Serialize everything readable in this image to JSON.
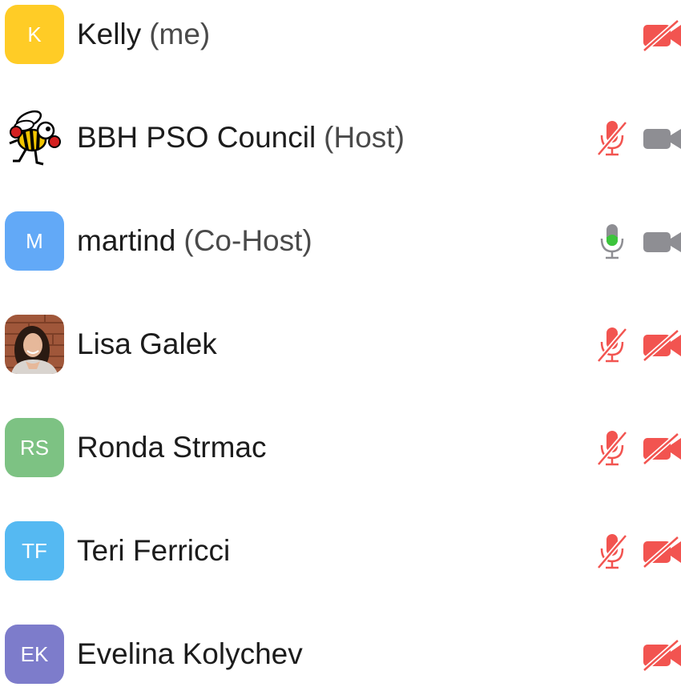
{
  "participants": [
    {
      "initials": "K",
      "name": "Kelly",
      "role": "(me)",
      "avatar_color": "#FFCC26",
      "avatar_type": "initials",
      "mic": "none",
      "video": "off"
    },
    {
      "initials": "",
      "name": "BBH PSO Council",
      "role": "(Host)",
      "avatar_color": "#ffffff",
      "avatar_type": "hornet-mascot-logo",
      "mic": "muted",
      "video": "on"
    },
    {
      "initials": "M",
      "name": "martind",
      "role": "(Co-Host)",
      "avatar_color": "#62A9F7",
      "avatar_type": "initials",
      "mic": "active",
      "video": "on"
    },
    {
      "initials": "",
      "name": "Lisa Galek",
      "role": "",
      "avatar_color": "#8a5a3b",
      "avatar_type": "photo",
      "mic": "muted",
      "video": "off"
    },
    {
      "initials": "RS",
      "name": "Ronda Strmac",
      "role": "",
      "avatar_color": "#7DC283",
      "avatar_type": "initials",
      "mic": "muted",
      "video": "off"
    },
    {
      "initials": "TF",
      "name": "Teri Ferricci",
      "role": "",
      "avatar_color": "#55B9F2",
      "avatar_type": "initials",
      "mic": "muted",
      "video": "off"
    },
    {
      "initials": "EK",
      "name": "Evelina Kolychev",
      "role": "",
      "avatar_color": "#7D7CCB",
      "avatar_type": "initials",
      "mic": "none",
      "video": "off"
    }
  ],
  "colors": {
    "muted_red": "#F25450",
    "inactive_gray": "#8E8E93",
    "active_green": "#3CC43C"
  },
  "icons": {
    "mic_muted": "microphone-muted-icon",
    "mic_active": "microphone-active-icon",
    "cam_on": "video-camera-icon",
    "cam_off": "video-camera-off-icon"
  }
}
